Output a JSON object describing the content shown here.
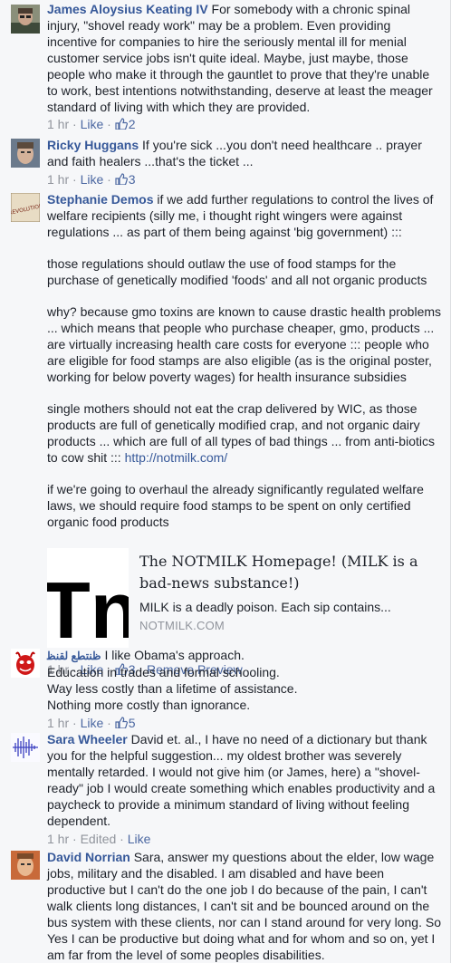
{
  "comments": [
    {
      "author": "James Aloysius Keating IV",
      "text": " For somebody with a chronic spinal injury, \"shovel ready work\" may be a problem. Even providing incentive for companies to hire the seriously mental ill for menial customer service jobs isn't quite ideal. Maybe, just maybe, those people who make it through the gauntlet to prove that they're unable to work, best intentions notwithstanding, deserve at least the meager standard of living with which they are provided.",
      "time": "1 hr",
      "like": "Like",
      "likes": "2"
    },
    {
      "author": "Ricky Huggans",
      "text": " If you're sick ...you don't need healthcare .. prayer and faith healers ...that's the ticket ...",
      "time": "1 hr",
      "like": "Like",
      "likes": "3"
    },
    {
      "author": "Stephanie Demos",
      "text": " if we add further regulations to control the lives of welfare recipients (silly me, i thought right wingers were against regulations ... as part of them being against 'big government) :::",
      "paragraphs": [
        "those regulations should outlaw the use of food stamps for the purchase of genetically modified 'foods' and all not organic products",
        "why? because gmo toxins are known to cause drastic health problems ... which means that people who purchase cheaper, gmo, products ... are virtually increasing health care costs for everyone ::: people who are eligible for food stamps are also eligible (as is the original poster, working for below poverty wages) for health insurance subsidies",
        "if we're going to overhaul the already significantly regulated welfare laws, we should require food stamps to be spent on only certified organic food products"
      ],
      "para3_text": "single mothers should not eat the crap delivered by WIC, as those products are full of genetically modified crap, and not organic dairy products ... which are full of all types of bad things ... from anti-biotics to cow shit ::: ",
      "para3_link": "http://notmilk.com/",
      "preview": {
        "logo": "Tn",
        "title": "The NOTMILK Homepage! (MILK is a bad-news substance!)",
        "description": "MILK is a deadly poison. Each sip contains...",
        "domain": "NOTMILK.COM"
      },
      "time": "1 hr",
      "like": "Like",
      "likes": "3",
      "remove_preview": "Remove Preview",
      "avatar_text": "REVOLUTION"
    },
    {
      "author": "ﻇﻨﺘﻄﻊ ﻟﻘﻨﻈ",
      "text": " I like Obama's approach.\nEducation in trades and formal schooling.\nWay less costly than a lifetime of assistance.\nNothing more costly than ignorance.",
      "time": "1 hr",
      "like": "Like",
      "likes": "5"
    },
    {
      "author": "Sara Wheeler",
      "text": " David et. al., I have no need of a dictionary but thank you for the helpful suggestion... my oldest brother was severely mentally retarded. I would not give him (or James, here) a \"shovel-ready\" job I would create something which enables productivity and a paycheck to provide a minimum standard of living without feeling dependent.",
      "time": "1 hr",
      "edited": "Edited",
      "like": "Like"
    },
    {
      "author": "David Norrian",
      "text": " Sara, answer my questions about the elder, low wage jobs, military and the disabled. I am disabled and have been productive but I can't do the one job I do because of the pain, I can't walk clients long distances, I can't sit and be bounced around on the bus system with these clients, nor can I stand around for very long. So Yes I can be productive but doing what and for whom and so on, yet I am far from the level of some peoples disabilities."
    }
  ],
  "separator": " · ",
  "colors": {
    "link": "#365899",
    "meta": "#90949c",
    "background": "#f6f7f9"
  }
}
